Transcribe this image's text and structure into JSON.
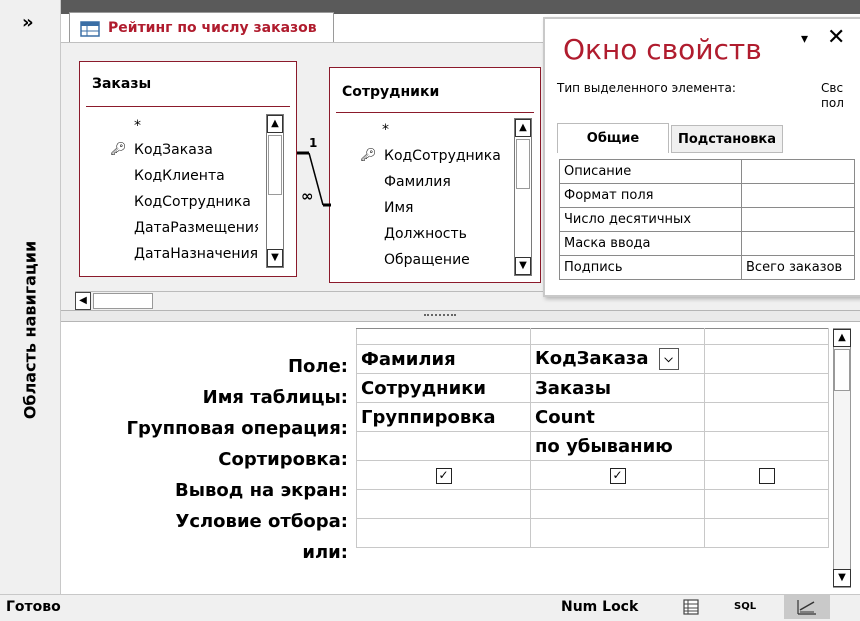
{
  "nav": {
    "toggle": "»",
    "label": "Область навигации"
  },
  "tab": {
    "title": "Рейтинг по числу заказов",
    "icon": "query-design-icon"
  },
  "tables": [
    {
      "title": "Заказы",
      "fields": [
        "*",
        "КодЗаказа",
        "КодКлиента",
        "КодСотрудника",
        "ДатаРазмещения",
        "ДатаНазначения"
      ],
      "key_field": "КодЗаказа"
    },
    {
      "title": "Сотрудники",
      "fields": [
        "*",
        "КодСотрудника",
        "Фамилия",
        "Имя",
        "Должность",
        "Обращение"
      ],
      "key_field": "КодСотрудника"
    }
  ],
  "relationship": {
    "one": "1",
    "many": "∞"
  },
  "property_sheet": {
    "title": "Окно свойств",
    "menu_icon": "▾",
    "close_icon": "✕",
    "selection_type_label": "Тип выделенного элемента:",
    "selection_type_value": "Свс\nпол",
    "tabs": [
      "Общие",
      "Подстановка"
    ],
    "rows": [
      {
        "name": "Описание",
        "value": ""
      },
      {
        "name": "Формат поля",
        "value": ""
      },
      {
        "name": "Число десятичных",
        "value": ""
      },
      {
        "name": "Маска ввода",
        "value": ""
      },
      {
        "name": "Подпись",
        "value": "Всего заказов"
      }
    ]
  },
  "grid": {
    "row_labels": [
      "Поле:",
      "Имя таблицы:",
      "Групповая операция:",
      "Сортировка:",
      "Вывод на экран:",
      "Условие отбора:",
      "или:"
    ],
    "columns": [
      {
        "field": "Фамилия",
        "table": "Сотрудники",
        "total": "Группировка",
        "sort": "",
        "show": true
      },
      {
        "field": "КодЗаказа",
        "table": "Заказы",
        "total": "Count",
        "sort": "по убыванию",
        "show": true
      },
      {
        "field": "",
        "table": "",
        "total": "",
        "sort": "",
        "show": false
      }
    ]
  },
  "status": {
    "ready": "Готово",
    "numlock": "Num Lock",
    "sql": "SQL"
  },
  "colors": {
    "accent": "#b01c2e",
    "table_border": "#8b1a2b"
  }
}
